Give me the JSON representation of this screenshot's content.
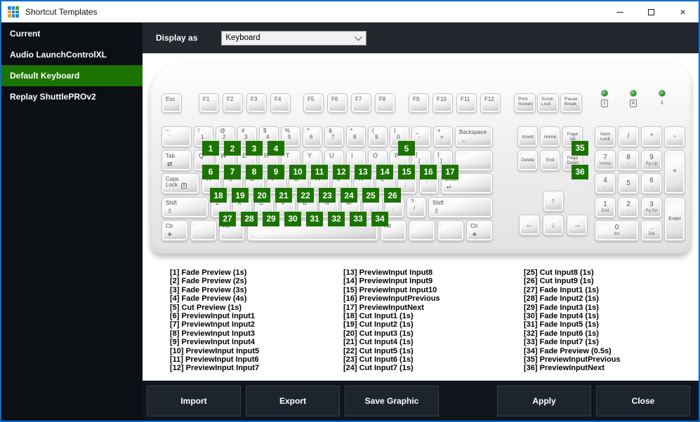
{
  "window": {
    "title": "Shortcut Templates",
    "border_color": "#0a6ed1",
    "icon_colors": [
      "#1e88d2",
      "#1e88d2",
      "#43a52c",
      "#f0a132",
      "#1e88d2",
      "#1e88d2",
      "#f0a132",
      "#1e88d2",
      "#1e88d2"
    ],
    "controls": [
      {
        "name": "minimize"
      },
      {
        "name": "maximize"
      },
      {
        "name": "close",
        "glyph": "×"
      }
    ]
  },
  "sidebar": {
    "selected_color": "#1b7400",
    "items": [
      {
        "label": "Current",
        "selected": false
      },
      {
        "label": "Audio LaunchControlXL",
        "selected": false
      },
      {
        "label": "Default Keyboard",
        "selected": true
      },
      {
        "label": "Replay ShuttlePROv2",
        "selected": false
      }
    ]
  },
  "header": {
    "display_as_label": "Display as",
    "dropdown_value": "Keyboard"
  },
  "keyboard": {
    "badge_color": "#1b7400",
    "esc": "Esc",
    "fgroups": [
      [
        "F1",
        "F2",
        "F3",
        "F4"
      ],
      [
        "F5",
        "F6",
        "F7",
        "F8"
      ],
      [
        "F9",
        "F10",
        "F11",
        "F12"
      ]
    ],
    "sys": [
      "Print\nScreen",
      "Scroll\nLock",
      "Pause\nBreak"
    ],
    "leds": [
      {
        "symbol": "1",
        "boxed": true
      },
      {
        "symbol": "A",
        "boxed": true
      },
      {
        "symbol": "⇩",
        "boxed": false
      }
    ],
    "main_rows": [
      [
        {
          "w": 1.5,
          "top": "~",
          "bot": "`"
        },
        {
          "top": "!",
          "bot": "1",
          "badge": "1"
        },
        {
          "top": "@",
          "bot": "2",
          "badge": "2"
        },
        {
          "top": "#",
          "bot": "3",
          "badge": "3"
        },
        {
          "top": "$",
          "bot": "4",
          "badge": "4"
        },
        {
          "top": "%",
          "bot": "5"
        },
        {
          "top": "^",
          "bot": "6"
        },
        {
          "top": "&",
          "bot": "7"
        },
        {
          "top": "*",
          "bot": "8"
        },
        {
          "top": "(",
          "bot": "9"
        },
        {
          "top": ")",
          "bot": "0",
          "badge": "5"
        },
        {
          "top": "_",
          "bot": "-"
        },
        {
          "top": "+",
          "bot": "="
        },
        {
          "w": 1.75,
          "label": "Backspace",
          "sub": "←",
          "grow": true
        }
      ],
      [
        {
          "w": 1.5,
          "label": "Tab",
          "sub": "⇄"
        },
        {
          "char": "Q",
          "badge": "6"
        },
        {
          "char": "W",
          "badge": "7"
        },
        {
          "char": "E",
          "badge": "8"
        },
        {
          "char": "R",
          "badge": "9"
        },
        {
          "char": "T",
          "badge": "10"
        },
        {
          "char": "Y",
          "badge": "11"
        },
        {
          "char": "U",
          "badge": "12"
        },
        {
          "char": "I",
          "badge": "13"
        },
        {
          "char": "O",
          "badge": "14"
        },
        {
          "char": "P",
          "badge": "15"
        },
        {
          "top": "{",
          "bot": "[",
          "badge": "16"
        },
        {
          "top": "}",
          "bot": "]",
          "badge": "17"
        },
        {
          "w": 1.75,
          "label": "",
          "grow": true
        }
      ],
      [
        {
          "w": 1.9,
          "label": "Caps\nLock",
          "boxchar": "A"
        },
        {
          "char": "A",
          "badge": "18"
        },
        {
          "char": "S",
          "badge": "19"
        },
        {
          "char": "D",
          "badge": "20"
        },
        {
          "char": "F",
          "badge": "21"
        },
        {
          "char": "G",
          "badge": "22"
        },
        {
          "char": "H",
          "badge": "23"
        },
        {
          "char": "J",
          "badge": "24"
        },
        {
          "char": "K",
          "badge": "25"
        },
        {
          "char": "L",
          "badge": "26"
        },
        {
          "top": ":",
          "bot": ";"
        },
        {
          "top": "\"",
          "bot": "'"
        },
        {
          "w": 1.85,
          "label": "Enter",
          "sub": "↵",
          "grow": true
        }
      ],
      [
        {
          "w": 2.35,
          "label": "Shift",
          "sub": "⇧"
        },
        {
          "char": "Z",
          "badge": "27"
        },
        {
          "char": "X",
          "badge": "28"
        },
        {
          "char": "C",
          "badge": "29"
        },
        {
          "char": "V",
          "badge": "30"
        },
        {
          "char": "B",
          "badge": "31"
        },
        {
          "char": "N",
          "badge": "32"
        },
        {
          "char": "M",
          "badge": "33"
        },
        {
          "top": "<",
          "bot": ",",
          "badge": "34"
        },
        {
          "top": ">",
          "bot": "."
        },
        {
          "top": "?",
          "bot": "/"
        },
        {
          "w": 2.0,
          "label": "Shift",
          "sub": "⇧",
          "grow": true
        }
      ],
      [
        {
          "w": 1.35,
          "label": "Ctr",
          "sub": "∗"
        },
        {
          "w": 1.35,
          "label": ""
        },
        {
          "w": 1.35,
          "label": "Alt"
        },
        {
          "w": 6.6,
          "label": "",
          "space": true
        },
        {
          "w": 1.35,
          "label": "Alt"
        },
        {
          "w": 1.35,
          "label": ""
        },
        {
          "w": 1.35,
          "label": ""
        },
        {
          "w": 1.35,
          "label": "Ctr",
          "sub": "∗",
          "grow": true
        }
      ]
    ],
    "nav_rows": [
      [
        {
          "label": "Insert"
        },
        {
          "label": "Home"
        },
        {
          "label": "Page\nUp",
          "badge": "35"
        }
      ],
      [
        {
          "label": "Delete"
        },
        {
          "label": "End"
        },
        {
          "label": "Page\nDown",
          "badge": "36"
        }
      ]
    ],
    "arrows": {
      "up": "↑",
      "left": "←",
      "down": "↓",
      "right": "→"
    },
    "numpad": [
      {
        "lines": "Num\nLock",
        "r": 1,
        "c": 1
      },
      {
        "main": "/",
        "r": 1,
        "c": 2
      },
      {
        "main": "*",
        "r": 1,
        "c": 3
      },
      {
        "main": "-",
        "r": 1,
        "c": 4
      },
      {
        "main": "7",
        "sub": "Home",
        "r": 2,
        "c": 1
      },
      {
        "main": "8",
        "sub": "↑",
        "r": 2,
        "c": 2
      },
      {
        "main": "9",
        "sub": "Pg Up",
        "r": 2,
        "c": 3
      },
      {
        "main": "+",
        "r": 2,
        "c": 4,
        "rs": 2
      },
      {
        "main": "4",
        "sub": "←",
        "r": 3,
        "c": 1
      },
      {
        "main": "5",
        "r": 3,
        "c": 2
      },
      {
        "main": "6",
        "sub": "→",
        "r": 3,
        "c": 3
      },
      {
        "main": "1",
        "sub": "End",
        "r": 4,
        "c": 1
      },
      {
        "main": "2",
        "sub": "↓",
        "r": 4,
        "c": 2
      },
      {
        "main": "3",
        "sub": "Pg Dn",
        "r": 4,
        "c": 3
      },
      {
        "main": "Enter",
        "small": true,
        "r": 4,
        "c": 4,
        "rs": 2
      },
      {
        "main": "0",
        "sub": "Ins",
        "r": 5,
        "c": 1,
        "cs": 2
      },
      {
        "main": ".",
        "sub": "Del",
        "r": 5,
        "c": 3
      }
    ]
  },
  "shortcuts": {
    "columns": [
      [
        "[1] Fade Preview (1s)",
        "[2] Fade Preview (2s)",
        "[3] Fade Preview (3s)",
        "[4] Fade Preview (4s)",
        "[5] Cut Preview (1s)",
        "[6] PreviewInput Input1",
        "[7] PreviewInput Input2",
        "[8] PreviewInput Input3",
        "[9] PreviewInput Input4",
        "[10] PreviewInput Input5",
        "[11] PreviewInput Input6",
        "[12] PreviewInput Input7"
      ],
      [
        "[13] PreviewInput Input8",
        "[14] PreviewInput Input9",
        "[15] PreviewInput Input10",
        "[16] PreviewInputPrevious",
        "[17] PreviewInputNext",
        "[18] Cut Input1 (1s)",
        "[19] Cut Input2 (1s)",
        "[20] Cut Input3 (1s)",
        "[21] Cut Input4 (1s)",
        "[22] Cut Input5 (1s)",
        "[23] Cut Input6 (1s)",
        "[24] Cut Input7 (1s)"
      ],
      [
        "[25] Cut Input8 (1s)",
        "[26] Cut Input9 (1s)",
        "[27] Fade Input1 (1s)",
        "[28] Fade Input2 (1s)",
        "[29] Fade Input3 (1s)",
        "[30] Fade Input4 (1s)",
        "[31] Fade Input5 (1s)",
        "[32] Fade Input6 (1s)",
        "[33] Fade Input7 (1s)",
        "[34] Fade Preview (0.5s)",
        "[35] PreviewInputPrevious",
        "[36] PreviewInputNext"
      ]
    ]
  },
  "footer": {
    "buttons": [
      "Import",
      "Export",
      "Save Graphic",
      "Apply",
      "Close"
    ]
  }
}
